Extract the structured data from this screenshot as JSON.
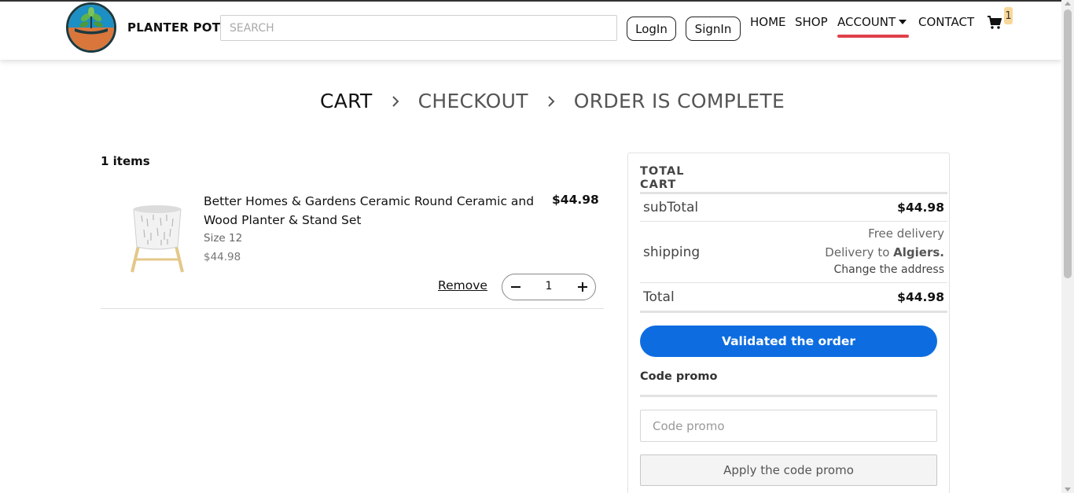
{
  "header": {
    "brand": "PLANTER POT",
    "search_placeholder": "SEARCH",
    "login_label": "LogIn",
    "signin_label": "SignIn",
    "nav": {
      "home": "HOME",
      "shop": "SHOP",
      "account": "ACCOUNT",
      "contact": "CONTACT"
    },
    "cart_count": "1",
    "accent_underline_color": "#e0414a"
  },
  "steps": [
    "CART",
    "CHECKOUT",
    "ORDER IS COMPLETE"
  ],
  "cart": {
    "items_count_label": "1 items",
    "items": [
      {
        "title": "Better Homes & Gardens Ceramic Round Ceramic and Wood Planter & Stand Set",
        "price": "$44.98",
        "size": "Size 12",
        "unit_price": "$44.98",
        "remove_label": "Remove",
        "quantity": "1"
      }
    ]
  },
  "summary": {
    "title": "TOTAL CART",
    "subtotal_label": "subTotal",
    "subtotal_value": "$44.98",
    "shipping_label": "shipping",
    "shipping_free": "Free delivery",
    "shipping_to_prefix": "Delivery to",
    "shipping_city": "Algiers.",
    "change_address": "Change the address",
    "total_label": "Total",
    "total_value": "$44.98",
    "validate_label": "Validated the order",
    "promo_label": "Code promo",
    "promo_placeholder": "Code promo",
    "apply_label": "Apply the code promo",
    "primary_color": "#0d6de0"
  },
  "icons": {
    "logo": "plant-logo-icon",
    "account_dropdown": "caret-down-icon",
    "cart": "shopping-cart-icon",
    "step_separator": "chevron-right-icon",
    "minus": "minus-icon",
    "plus": "plus-icon"
  }
}
